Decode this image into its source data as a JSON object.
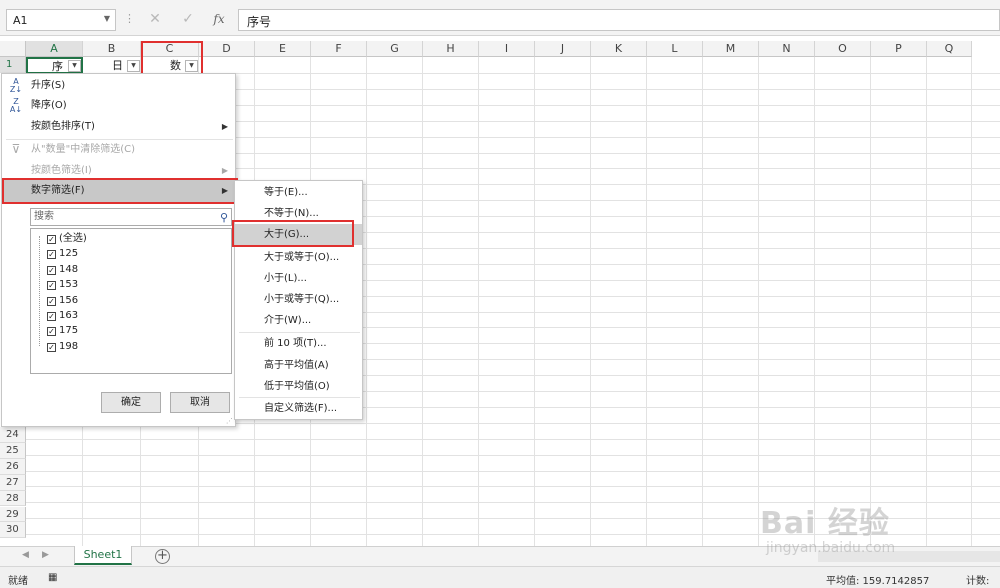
{
  "formula_bar": {
    "name_box": "A1",
    "cancel_icon": "✕",
    "enter_icon": "✓",
    "fx_label": "fx",
    "content": "序号"
  },
  "columns": [
    "A",
    "B",
    "C",
    "D",
    "E",
    "F",
    "G",
    "H",
    "I",
    "J",
    "K",
    "L",
    "M",
    "N",
    "O",
    "P",
    "Q"
  ],
  "rows_top": [
    "1"
  ],
  "rows_bottom": [
    "24",
    "25",
    "26",
    "27",
    "28",
    "29",
    "30"
  ],
  "header_row": {
    "a": "序",
    "b": "日",
    "c": "数"
  },
  "filter_menu": {
    "items": {
      "sort_asc": "升序(S)",
      "sort_desc": "降序(O)",
      "sort_by_color": "按颜色排序(T)",
      "clear_filter": "从\"数量\"中清除筛选(C)",
      "filter_by_color": "按颜色筛选(I)",
      "number_filter": "数字筛选(F)"
    },
    "search_placeholder": "搜索",
    "values": [
      "(全选)",
      "125",
      "148",
      "153",
      "156",
      "163",
      "175",
      "198"
    ],
    "ok": "确定",
    "cancel": "取消"
  },
  "number_filter_submenu": [
    "等于(E)...",
    "不等于(N)...",
    "大于(G)...",
    "大于或等于(O)...",
    "小于(L)...",
    "小于或等于(Q)...",
    "介于(W)...",
    "前 10 项(T)...",
    "高于平均值(A)",
    "低于平均值(O)",
    "自定义筛选(F)..."
  ],
  "sheet_tab": "Sheet1",
  "status_bar": {
    "ready": "就绪",
    "average": "平均值: 159.7142857",
    "count": "计数: "
  },
  "watermark": {
    "logo": "Bai 经验",
    "url": "jingyan.baidu.com"
  },
  "colors": {
    "excel_green": "#217346",
    "highlight_red": "#e0302f"
  }
}
